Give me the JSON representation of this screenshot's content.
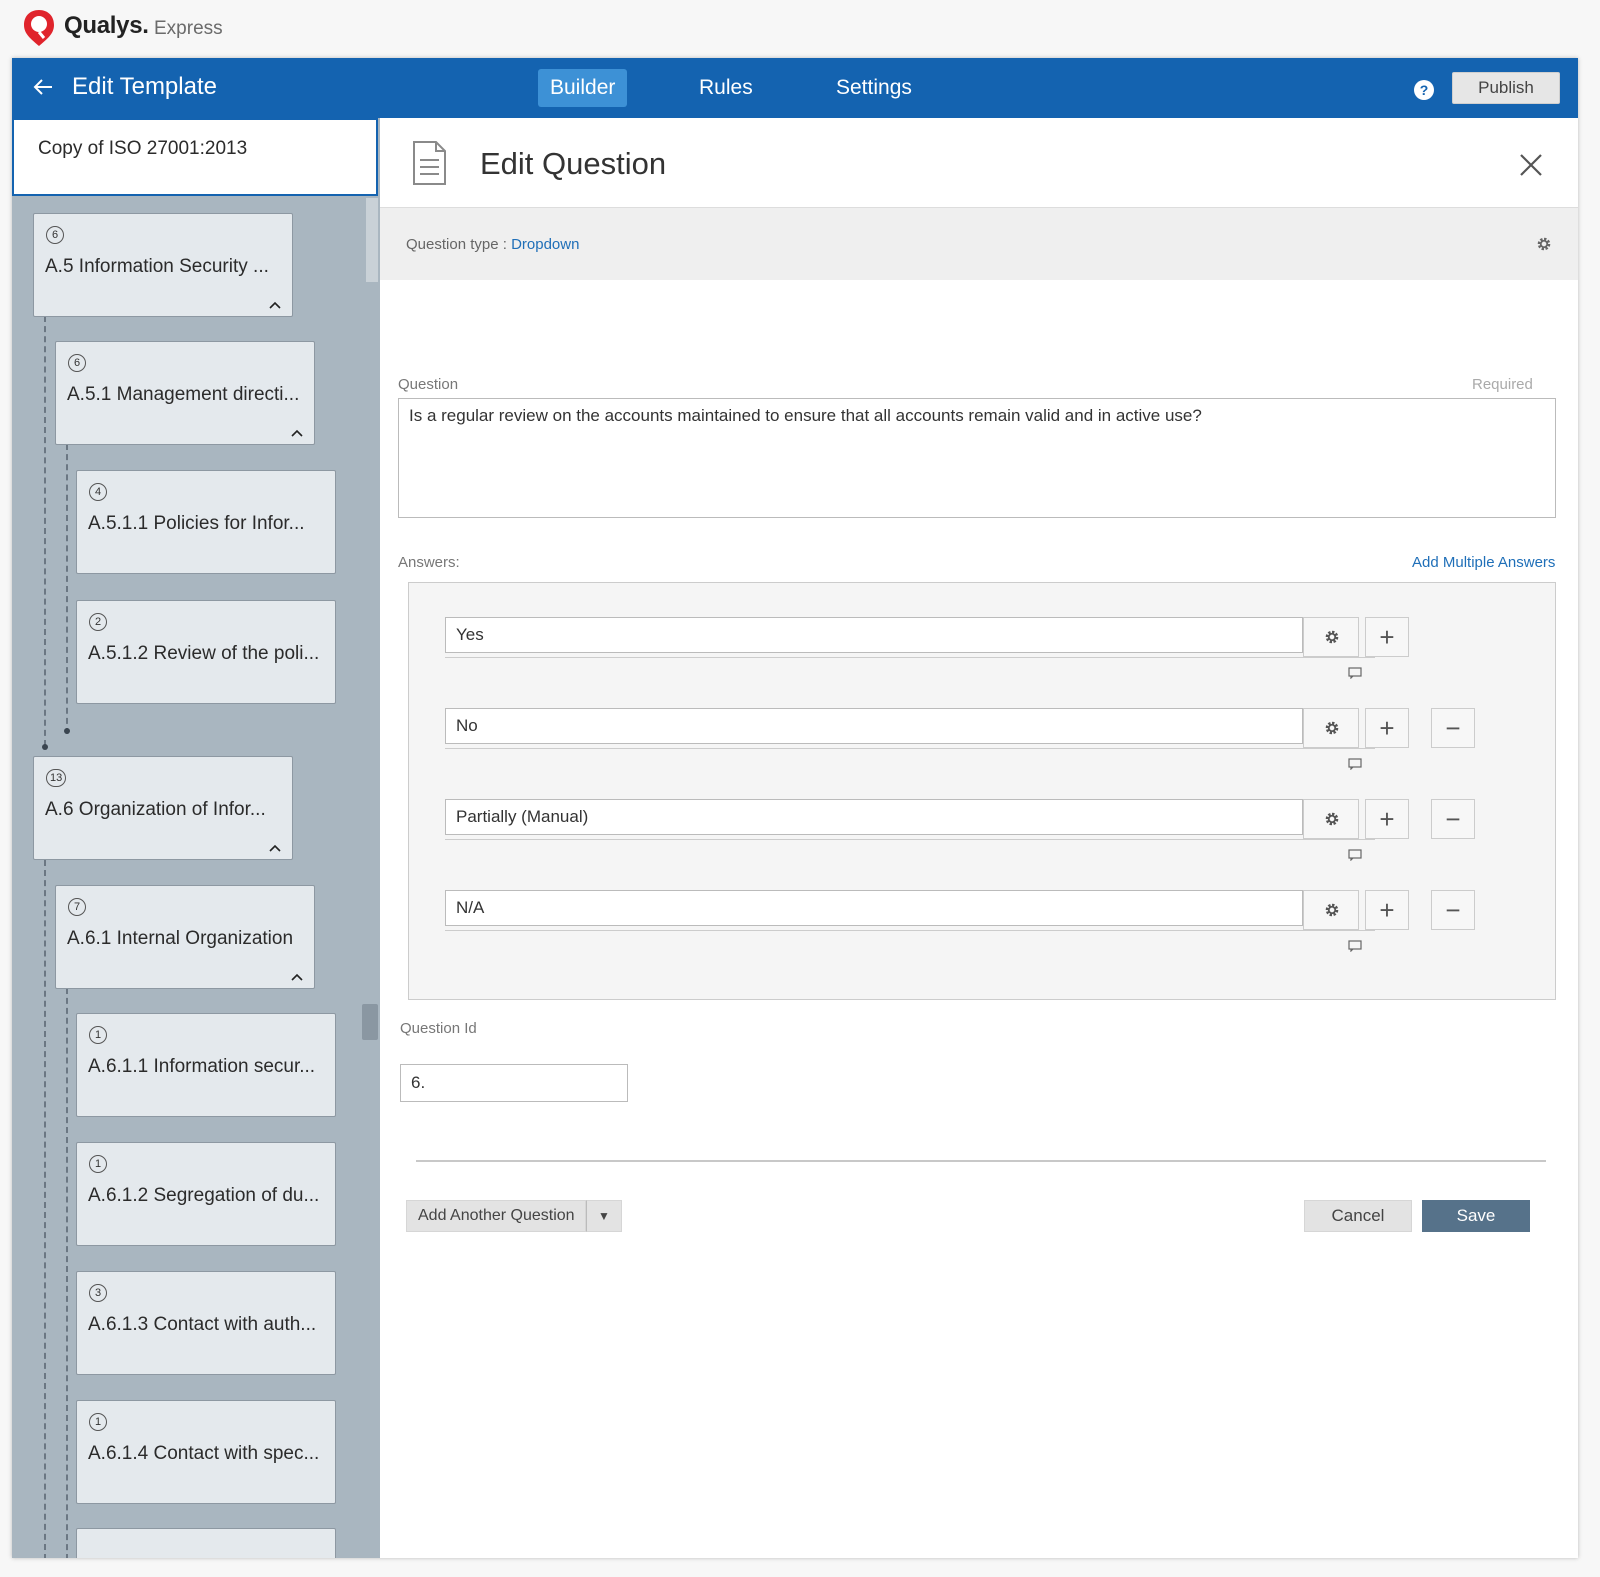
{
  "brand": {
    "name": "Qualys.",
    "product": "Express"
  },
  "topnav": {
    "title": "Edit Template",
    "tabs": [
      {
        "label": "Builder",
        "active": true
      },
      {
        "label": "Rules",
        "active": false
      },
      {
        "label": "Settings",
        "active": false
      }
    ],
    "help": "?",
    "publish_label": "Publish"
  },
  "sidebar": {
    "template_name": "Copy of ISO 27001:2013",
    "nodes": [
      {
        "count": "6",
        "label": "A.5 Information Security ...",
        "collapsible": true
      },
      {
        "count": "6",
        "label": "A.5.1 Management directi...",
        "collapsible": true
      },
      {
        "count": "4",
        "label": "A.5.1.1 Policies for Infor...",
        "collapsible": false
      },
      {
        "count": "2",
        "label": "A.5.1.2 Review of the poli...",
        "collapsible": false
      },
      {
        "count": "13",
        "label": "A.6 Organization of Infor...",
        "collapsible": true
      },
      {
        "count": "7",
        "label": "A.6.1 Internal Organization",
        "collapsible": true
      },
      {
        "count": "1",
        "label": "A.6.1.1 Information secur...",
        "collapsible": false
      },
      {
        "count": "1",
        "label": "A.6.1.2 Segregation of du...",
        "collapsible": false
      },
      {
        "count": "3",
        "label": "A.6.1.3 Contact with auth...",
        "collapsible": false
      },
      {
        "count": "1",
        "label": "A.6.1.4 Contact with spec...",
        "collapsible": false
      }
    ]
  },
  "editor": {
    "title": "Edit Question",
    "question_type_label": "Question type : ",
    "question_type_value": "Dropdown",
    "question_label": "Question",
    "required_label": "Required",
    "question_text": "Is a regular review on the accounts maintained to ensure that all accounts remain valid and in active use?",
    "answers_label": "Answers:",
    "add_multiple_label": "Add Multiple Answers",
    "answers": [
      "Yes",
      "No",
      "Partially (Manual)",
      "N/A"
    ],
    "question_id_label": "Question Id",
    "question_id_value": "6.",
    "add_another_label": "Add Another Question",
    "cancel_label": "Cancel",
    "save_label": "Save"
  },
  "colors": {
    "nav": "#1463b0",
    "active_tab": "#3d91d6",
    "link": "#1f6fb8",
    "save": "#56728a",
    "sidebar": "#a9b6c0"
  },
  "icons": [
    "back-arrow-icon",
    "help-icon",
    "document-icon",
    "close-icon",
    "gear-icon",
    "plus-icon",
    "minus-icon",
    "comment-icon",
    "chevron-up-icon",
    "caret-down-icon"
  ]
}
